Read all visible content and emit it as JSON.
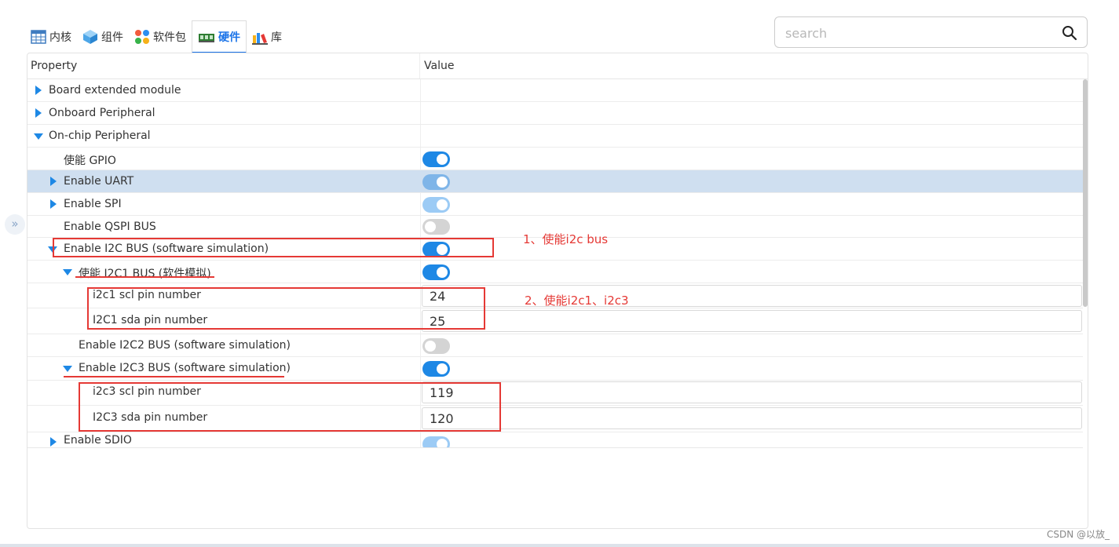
{
  "tabs": [
    {
      "label": "内核",
      "icon": "table-icon"
    },
    {
      "label": "组件",
      "icon": "cube-icon"
    },
    {
      "label": "软件包",
      "icon": "packages-icon"
    },
    {
      "label": "硬件",
      "icon": "board-icon",
      "active": true
    },
    {
      "label": "库",
      "icon": "library-icon"
    }
  ],
  "search": {
    "placeholder": "search",
    "value": ""
  },
  "table": {
    "col_property": "Property",
    "col_value": "Value"
  },
  "rows": [
    {
      "label": "Board extended module",
      "expand": "collapsed"
    },
    {
      "label": "Onboard Peripheral",
      "expand": "collapsed"
    },
    {
      "label": "On-chip Peripheral",
      "expand": "expanded"
    },
    {
      "label": "使能 GPIO",
      "value": "on"
    },
    {
      "label": "Enable UART",
      "expand": "collapsed",
      "value": "on-dim",
      "selected": true
    },
    {
      "label": "Enable SPI",
      "expand": "collapsed",
      "value": "on-dim"
    },
    {
      "label": "Enable QSPI BUS",
      "value": "off"
    },
    {
      "label": "Enable I2C BUS (software simulation)",
      "expand": "expanded",
      "value": "on"
    },
    {
      "label": "使能 I2C1 BUS (软件模拟)",
      "expand": "expanded",
      "value": "on"
    },
    {
      "label": "i2c1 scl pin number",
      "value": "24"
    },
    {
      "label": "I2C1 sda pin number",
      "value": "25"
    },
    {
      "label": "Enable I2C2 BUS (software simulation)",
      "value": "off"
    },
    {
      "label": "Enable I2C3 BUS (software simulation)",
      "expand": "expanded",
      "value": "on"
    },
    {
      "label": "i2c3 scl pin number",
      "value": "119"
    },
    {
      "label": "I2C3 sda pin number",
      "value": "120"
    },
    {
      "label": "Enable SDIO",
      "expand": "collapsed",
      "value": "on-dim"
    }
  ],
  "annotations": {
    "note1": "1、使能i2c bus",
    "note2": "2、使能i2c1、i2c3"
  },
  "watermark": "CSDN @以放_",
  "colors": {
    "accent": "#1e88e5",
    "annotation": "#e53935",
    "selected_row": "#cfdff0"
  }
}
